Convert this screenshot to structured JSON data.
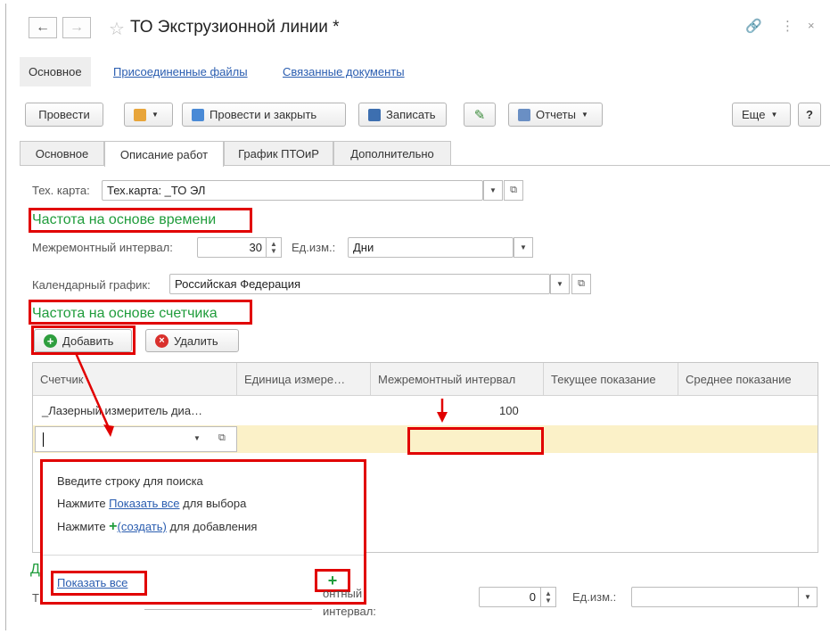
{
  "window": {
    "title": "ТО Экструзионной линии *"
  },
  "navbar": {
    "main_label": "Основное",
    "links": [
      "Присоединенные файлы",
      "Связанные документы"
    ]
  },
  "toolbar": {
    "post": "Провести",
    "post_close": "Провести и закрыть",
    "save": "Записать",
    "reports": "Отчеты",
    "more": "Еще",
    "help": "?"
  },
  "tabs": [
    "Основное",
    "Описание работ",
    "График ПТОиР",
    "Дополнительно"
  ],
  "form": {
    "tech_card_label": "Тех. карта:",
    "tech_card_value": "Тех.карта: _ТО ЭЛ",
    "time_section": "Частота на основе времени",
    "interval_label": "Межремонтный интервал:",
    "interval_value": "30",
    "unit_label": "Ед.изм.:",
    "unit_value": "Дни",
    "calendar_label": "Календарный график:",
    "calendar_value": "Российская Федерация",
    "counter_section": "Частота на основе счетчика",
    "add_label": "Добавить",
    "delete_label": "Удалить"
  },
  "table": {
    "columns": [
      "Счетчик",
      "Единица измере…",
      "Межремонтный интервал",
      "Текущее показание",
      "Среднее показание"
    ],
    "rows": [
      {
        "counter": "_Лазерный измеритель диа…",
        "unit": "",
        "interval": "100",
        "current": "",
        "avg": ""
      }
    ]
  },
  "popup": {
    "line1": "Введите строку для поиска",
    "line2_pre": "Нажмите ",
    "line2_link": "Показать все",
    "line2_post": " для выбора",
    "line3_pre": "Нажмите ",
    "line3_link": "(создать)",
    "line3_post": " для добавления",
    "show_all": "Показать все",
    "plus": "+"
  },
  "bottom": {
    "partial_left": "Д",
    "partial_left2": "Т",
    "interval_label_1": "онтный",
    "interval_label_2": "интервал:",
    "interval_value": "0",
    "unit_label": "Ед.изм.:"
  }
}
